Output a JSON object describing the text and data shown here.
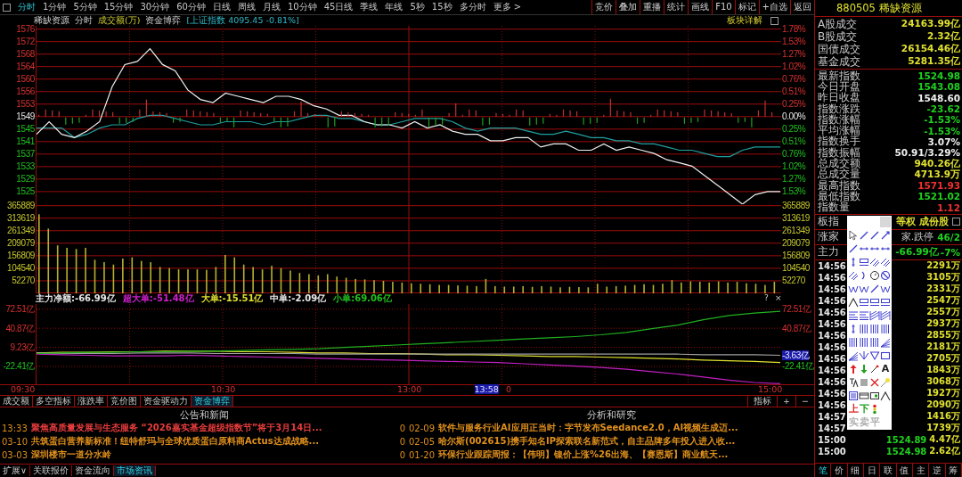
{
  "toolbar": {
    "periods": [
      {
        "label": "分时",
        "selected": true
      },
      {
        "label": "1分钟",
        "selected": false
      },
      {
        "label": "5分钟",
        "selected": false
      },
      {
        "label": "15分钟",
        "selected": false
      },
      {
        "label": "30分钟",
        "selected": false
      },
      {
        "label": "60分钟",
        "selected": false
      },
      {
        "label": "日线",
        "selected": false
      },
      {
        "label": "周线",
        "selected": false
      },
      {
        "label": "月线",
        "selected": false
      },
      {
        "label": "10分钟",
        "selected": false
      },
      {
        "label": "45日线",
        "selected": false
      },
      {
        "label": "季线",
        "selected": false
      },
      {
        "label": "年线",
        "selected": false
      },
      {
        "label": "5秒",
        "selected": false
      },
      {
        "label": "15秒",
        "selected": false
      },
      {
        "label": "多分时",
        "selected": false
      },
      {
        "label": "更多 >",
        "selected": false
      }
    ],
    "actions": [
      "竞价",
      "叠加",
      "重播",
      "统计",
      "画线",
      "F10",
      "标记",
      "+自选",
      "返回"
    ]
  },
  "chart_header": {
    "name": "稀缺资源",
    "mode": "分时",
    "volume_label": "成交额(万)",
    "indicator": "资金博弈",
    "index_info": "[上证指数 4095.45 -0.81%]",
    "sector_link": "板块详解"
  },
  "price_panel": {
    "right_axis": [
      "1.78%",
      "1.53%",
      "1.27%",
      "1.02%",
      "0.76%",
      "0.51%",
      "0.25%",
      "0.00%",
      "0.25%",
      "0.51%",
      "0.76%",
      "1.02%",
      "1.27%",
      "1.53%"
    ],
    "chart_data": {
      "type": "line",
      "ylim": [
        1521.0,
        1577.2
      ],
      "grid": true,
      "yticks": [
        {
          "value": 1576.18,
          "label": "1576"
        },
        {
          "value": 1572.24,
          "label": "1572"
        },
        {
          "value": 1568.3,
          "label": "1568"
        },
        {
          "value": 1564.36,
          "label": "1564"
        },
        {
          "value": 1560.42,
          "label": "1560"
        },
        {
          "value": 1556.48,
          "label": "1556"
        },
        {
          "value": 1552.54,
          "label": "1553"
        },
        {
          "value": 1548.6,
          "label": "1549"
        },
        {
          "value": 1544.66,
          "label": "1545"
        },
        {
          "value": 1540.72,
          "label": "1541"
        },
        {
          "value": 1536.78,
          "label": "1537"
        },
        {
          "value": 1532.84,
          "label": "1533"
        },
        {
          "value": 1528.9,
          "label": "1529"
        },
        {
          "value": 1524.96,
          "label": "1525"
        }
      ],
      "series": [
        {
          "color": "#f0f0f0",
          "values": [
            1543,
            1547,
            1543,
            1542,
            1544,
            1547,
            1558,
            1565,
            1566,
            1570,
            1565,
            1563,
            1557,
            1554,
            1553,
            1556,
            1555,
            1554,
            1553,
            1555,
            1555,
            1554,
            1552,
            1551,
            1549,
            1549,
            1547,
            1546,
            1546,
            1545,
            1547,
            1545,
            1546,
            1544,
            1543,
            1543,
            1541,
            1541,
            1542,
            1542,
            1539,
            1540,
            1540,
            1538,
            1538,
            1540,
            1538,
            1539,
            1538,
            1537,
            1535,
            1534,
            1533,
            1530,
            1527,
            1524,
            1521,
            1524,
            1525,
            1525
          ]
        },
        {
          "color": "#1fa0a0",
          "values": [
            1545,
            1545,
            1545,
            1542,
            1543,
            1545,
            1546,
            1546,
            1548,
            1549,
            1549,
            1548,
            1547,
            1546,
            1546,
            1547,
            1547,
            1547,
            1546,
            1547,
            1547,
            1548,
            1549,
            1549,
            1548,
            1548,
            1547,
            1546,
            1546,
            1547,
            1548,
            1548,
            1548,
            1547,
            1545,
            1544,
            1545,
            1545,
            1545,
            1544,
            1543,
            1543,
            1544,
            1543,
            1542,
            1542,
            1541,
            1541,
            1540,
            1540,
            1539,
            1538,
            1538,
            1537,
            1536,
            1536,
            1538,
            1539,
            1539,
            1539
          ]
        }
      ]
    }
  },
  "volume_panel": {
    "right_axis": [
      "365889",
      "313619",
      "261349",
      "209079",
      "156809",
      "104540",
      "52270"
    ],
    "chart_data": {
      "type": "bar",
      "ylim": [
        0,
        372000
      ],
      "grid": true,
      "yticks": [
        {
          "value": 365889,
          "label": "365889"
        },
        {
          "value": 313619,
          "label": "313619"
        },
        {
          "value": 261349,
          "label": "261349"
        },
        {
          "value": 209079,
          "label": "209079"
        },
        {
          "value": 156809,
          "label": "156809"
        },
        {
          "value": 104540,
          "label": "104540"
        },
        {
          "value": 52270,
          "label": "52270"
        }
      ],
      "series": [
        {
          "color": "#b8b030",
          "values": [
            330000,
            270000,
            200000,
            190000,
            185000,
            190000,
            140000,
            130000,
            120000,
            145000,
            150000,
            135000,
            130000,
            110000,
            105000,
            100000,
            100000,
            100000,
            98000,
            110000,
            160000,
            150000,
            120000,
            110000,
            100000,
            115000,
            105000,
            95000,
            85000,
            80000,
            75000,
            80000,
            70000,
            65000,
            60000,
            58000,
            55000,
            52000,
            48000,
            45000,
            42000,
            40000,
            38000,
            35000,
            35000,
            33000,
            32000,
            30000,
            60000,
            30000,
            28000,
            28000,
            30000,
            27000,
            30000,
            28000,
            25000,
            27000,
            26000,
            25000,
            40000,
            28000,
            30000,
            32000,
            35000,
            38000,
            35000,
            40000,
            55000,
            45000,
            50000,
            48000,
            45000,
            50000,
            45000,
            48000,
            42000,
            40000,
            35000,
            48000
          ]
        }
      ]
    }
  },
  "flow_panel": {
    "legend": [
      {
        "text": "主力净额:-66.99亿",
        "color": "#e8e8e8"
      },
      {
        "text": "超大单:-51.48亿",
        "color": "#d020d0"
      },
      {
        "text": "大单:-15.51亿",
        "color": "#e0e030"
      },
      {
        "text": "中单:-2.09亿",
        "color": "#e8e8e8"
      },
      {
        "text": "小单:69.06亿",
        "color": "#20c020"
      }
    ],
    "controls": [
      "?",
      "×"
    ],
    "right_axis": [
      {
        "label": "72.51亿",
        "current": false
      },
      {
        "label": "40.87亿",
        "current": false
      },
      {
        "label": "-3.63亿",
        "current": true
      },
      {
        "label": "-22.41亿",
        "current": false
      }
    ],
    "chart_data": {
      "type": "line",
      "ylim": [
        -52,
        81
      ],
      "grid": true,
      "yticks": [
        {
          "value": 72.51,
          "label": "72.51亿"
        },
        {
          "value": 40.87,
          "label": "40.87亿"
        },
        {
          "value": 9.23,
          "label": "9.23亿"
        },
        {
          "value": -22.41,
          "label": "-22.41亿"
        }
      ],
      "series": [
        {
          "color": "#20b020",
          "values": [
            -1,
            0,
            1,
            1,
            2,
            2,
            3,
            3,
            4,
            5,
            6,
            7,
            9,
            11,
            13,
            15,
            17,
            19,
            21,
            23,
            25,
            27,
            30,
            34,
            40,
            46,
            55,
            62,
            66,
            69
          ]
        },
        {
          "color": "#a0a0a0",
          "values": [
            0,
            -1,
            -1,
            -1,
            0,
            0,
            0,
            -1,
            -1,
            -1,
            -1,
            -2,
            -2,
            -2,
            -2,
            -2,
            -2,
            -2,
            -2,
            -2,
            -2,
            -2,
            -2,
            -2,
            -2,
            -2,
            -3,
            -3,
            -3,
            -4
          ]
        },
        {
          "color": "#e0e030",
          "values": [
            0,
            1,
            1,
            2,
            2,
            3,
            3,
            3,
            2,
            2,
            1,
            0,
            0,
            -1,
            -1,
            -2,
            -3,
            -3,
            -4,
            -5,
            -6,
            -6,
            -7,
            -8,
            -9,
            -10,
            -12,
            -13,
            -14,
            -16
          ]
        },
        {
          "color": "#c020c0",
          "values": [
            -2,
            -3,
            -4,
            -5,
            -5,
            -5,
            -4,
            -5,
            -6,
            -7,
            -8,
            -9,
            -10,
            -11,
            -12,
            -13,
            -14,
            -15,
            -16,
            -18,
            -20,
            -22,
            -24,
            -27,
            -31,
            -35,
            -40,
            -45,
            -49,
            -51
          ]
        }
      ]
    }
  },
  "time_axis": {
    "ticks": [
      "09:30",
      "10:30",
      "13:00",
      "0",
      "15:00"
    ],
    "cursor": "13:58"
  },
  "indicator_tabs": [
    {
      "label": "成交额",
      "selected": false
    },
    {
      "label": "多空指标",
      "selected": false
    },
    {
      "label": "涨跌率",
      "selected": false
    },
    {
      "label": "竞价图",
      "selected": false
    },
    {
      "label": "资金驱动力",
      "selected": false
    },
    {
      "label": "资金博弈",
      "selected": true
    }
  ],
  "indicator_controls": {
    "label": "指标",
    "zoom_in": "+",
    "zoom_out": "−"
  },
  "news": [
    {
      "title": "公告和新闻",
      "items": [
        {
          "date": "13:33",
          "text": "聚焦高质量发展与生态服务 “2026嘉实基金超级指数节”将于3月14日...",
          "color": "#e83c3c",
          "tail": "0"
        },
        {
          "date": "03-10",
          "text": "共筑蛋白营养新标准！纽特舒玛与全球优质蛋白原料商Actus达成战略...",
          "color": "#e0901c",
          "tail": "0"
        },
        {
          "date": "03-03",
          "text": "深圳楼市一道分水岭",
          "color": "#e0901c",
          "tail": "0"
        }
      ]
    },
    {
      "title": "分析和研究",
      "items": [
        {
          "date": "02-09",
          "text": "软件与服务行业AI应用正当时：字节发布Seedance2.0，AI视频生成迈...",
          "color": "#e0901c"
        },
        {
          "date": "02-05",
          "text": "哈尔斯(002615)携手知名IP探索联名新范式，自主品牌多年投入进入收...",
          "color": "#e0901c"
        },
        {
          "date": "01-20",
          "text": "环保行业跟踪周报：【伟明】镍价上涨%26出海、【赛恩斯】商业航天...",
          "color": "#e0901c"
        }
      ]
    }
  ],
  "bottom_tabs": [
    {
      "label": "扩展∨",
      "selected": false
    },
    {
      "label": "关联报价",
      "selected": false
    },
    {
      "label": "资金流向",
      "selected": false
    },
    {
      "label": "市场资讯",
      "selected": true
    }
  ],
  "quote": {
    "title": "880505 稀缺资源",
    "market_totals": [
      {
        "label": "A股成交",
        "value": "24163.99亿"
      },
      {
        "label": "B股成交",
        "value": "2.32亿"
      },
      {
        "label": "国债成交",
        "value": "26154.46亿"
      },
      {
        "label": "基金成交",
        "value": "5281.35亿"
      }
    ],
    "stats": [
      {
        "label": "最新指数",
        "value": "1524.98",
        "color": "#20d020"
      },
      {
        "label": "今日开盘",
        "value": "1543.08",
        "color": "#20d020"
      },
      {
        "label": "昨日收盘",
        "value": "1548.60",
        "color": "#f0f0f0"
      },
      {
        "label": "指数涨跌",
        "value": "-23.62",
        "color": "#20d020"
      },
      {
        "label": "指数涨幅",
        "value": "-1.53%",
        "color": "#20d020"
      },
      {
        "label": "平均涨幅",
        "value": "-1.53%",
        "color": "#20d020"
      },
      {
        "label": "指数换手",
        "value": "3.07%",
        "color": "#f0f0f0"
      },
      {
        "label": "指数振幅",
        "value": "50.91/3.29%",
        "color": "#f0f0f0"
      },
      {
        "label": "总成交额",
        "value": "940.26亿",
        "color": "#e0e030"
      },
      {
        "label": "总成交量",
        "value": "4713.9万",
        "color": "#e0e030"
      },
      {
        "label": "最高指数",
        "value": "1571.93",
        "color": "#f03030"
      },
      {
        "label": "最低指数",
        "value": "1521.02",
        "color": "#20d020"
      },
      {
        "label": "指数量",
        "value": "1.12",
        "color": "#f03030"
      }
    ],
    "sector_row": {
      "label": "板指",
      "links": [
        "等权",
        "成份股"
      ]
    },
    "breadth_row": {
      "label": "涨家",
      "right_label": "家.跌停",
      "value": "46/2"
    },
    "main_force_row": {
      "label": "主力",
      "value": "-66.99亿",
      "share": "-7%"
    },
    "ticks": [
      {
        "time": "14:56",
        "volume": "2291万"
      },
      {
        "time": "14:56",
        "volume": "3105万"
      },
      {
        "time": "14:56",
        "volume": "2331万"
      },
      {
        "time": "14:56",
        "volume": "2547万"
      },
      {
        "time": "14:56",
        "volume": "2557万"
      },
      {
        "time": "14:56",
        "volume": "2937万"
      },
      {
        "time": "14:56",
        "volume": "2855万"
      },
      {
        "time": "14:56",
        "volume": "2181万"
      },
      {
        "time": "14:56",
        "volume": "2705万"
      },
      {
        "time": "14:56",
        "volume": "1843万"
      },
      {
        "time": "14:56",
        "volume": "3068万"
      },
      {
        "time": "14:56",
        "volume": "1927万"
      },
      {
        "time": "14:56",
        "volume": "2090万"
      },
      {
        "time": "14:57",
        "volume": "1416万"
      },
      {
        "time": "14:57",
        "volume": "1739万"
      },
      {
        "time": "15:00",
        "price": "1524.89",
        "volume": "4.47亿"
      },
      {
        "time": "15:00",
        "price": "1524.98",
        "volume": "2.62亿"
      }
    ],
    "tabs": [
      {
        "label": "笔",
        "selected": true
      },
      {
        "label": "价",
        "selected": false
      },
      {
        "label": "细",
        "selected": false
      },
      {
        "label": "日",
        "selected": false
      },
      {
        "label": "联",
        "selected": false
      },
      {
        "label": "值",
        "selected": false
      },
      {
        "label": "主",
        "selected": false
      },
      {
        "label": "逆",
        "selected": false
      },
      {
        "label": "筹",
        "selected": false
      }
    ]
  },
  "drawing_palette": {
    "text_tools": [
      {
        "label": "A",
        "color": "#202020"
      },
      {
        "label": "上",
        "color": "#e02020"
      },
      {
        "label": "下",
        "color": "#20a020"
      },
      {
        "label": "实",
        "color": "#b0b0b0"
      },
      {
        "label": "卖",
        "color": "#b0b0b0"
      },
      {
        "label": "平",
        "color": "#b0b0b0"
      }
    ]
  }
}
